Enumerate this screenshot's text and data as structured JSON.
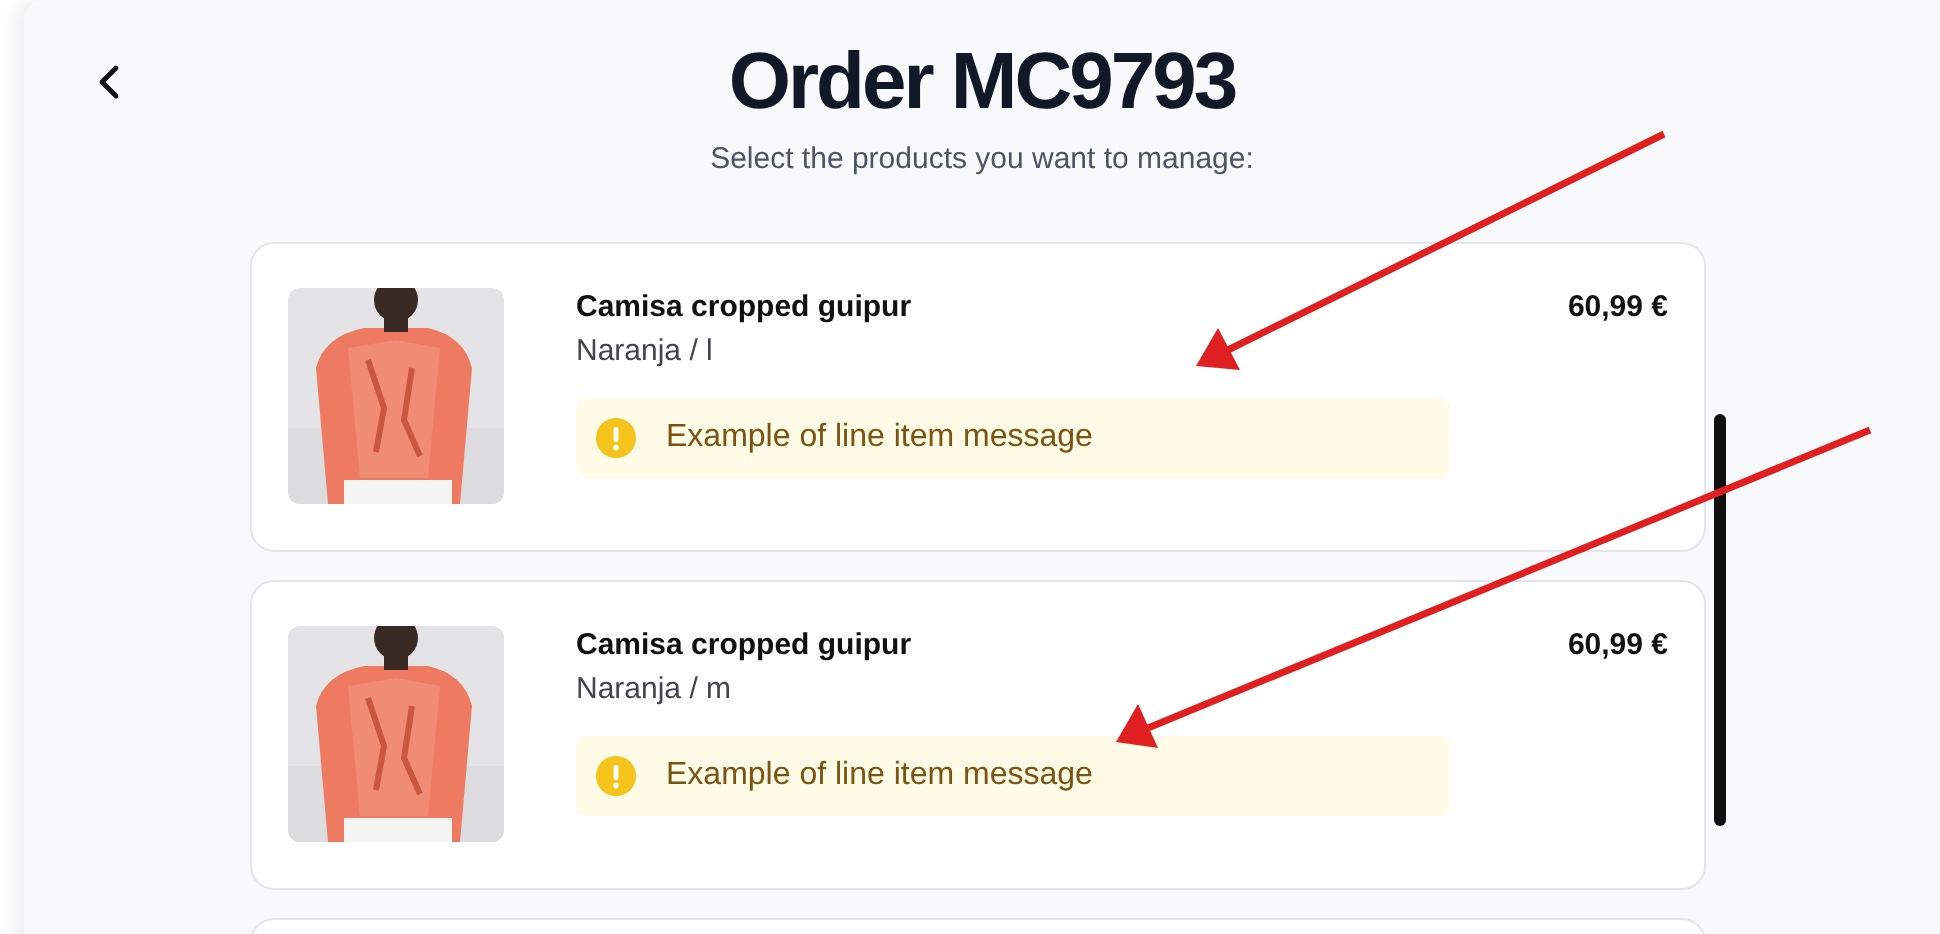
{
  "header": {
    "title": "Order MC9793",
    "subtitle": "Select the products you want to manage:"
  },
  "items": [
    {
      "name": "Camisa cropped guipur",
      "variant": "Naranja / l",
      "price": "60,99 €",
      "message": {
        "kind": "warning",
        "text": "Example of line item message"
      }
    },
    {
      "name": "Camisa cropped guipur",
      "variant": "Naranja / m",
      "price": "60,99 €",
      "message": {
        "kind": "warning",
        "text": "Example of line item message"
      }
    }
  ]
}
